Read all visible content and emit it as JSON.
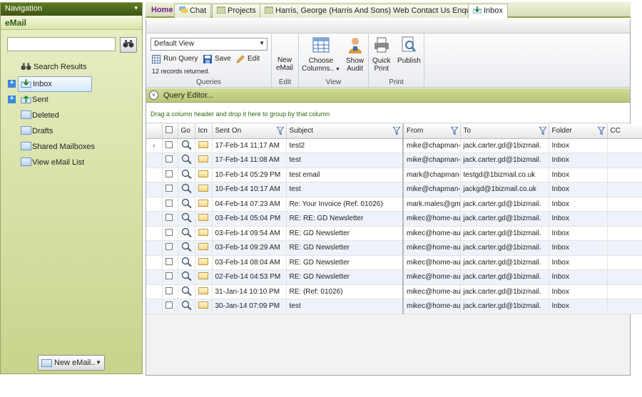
{
  "nav": {
    "header": "Navigation",
    "section_title": "eMail",
    "search_placeholder": "",
    "items": [
      {
        "label": "Search Results",
        "icon": "binoculars-icon"
      },
      {
        "label": "Inbox",
        "icon": "inbox-icon"
      },
      {
        "label": "Sent",
        "icon": "sent-icon"
      },
      {
        "label": "Deleted",
        "icon": "envelope-icon"
      },
      {
        "label": "Drafts",
        "icon": "envelope-icon"
      },
      {
        "label": "Shared Mailboxes",
        "icon": "envelope-icon"
      },
      {
        "label": "View eMail List",
        "icon": "envelope-icon"
      }
    ],
    "new_email": "New eMail.."
  },
  "tabs": [
    {
      "label": "Home"
    },
    {
      "label": "Chat"
    },
    {
      "label": "Projects"
    },
    {
      "label": "Harris, George (Harris And Sons) Web Contact Us Enquiry"
    },
    {
      "label": "Inbox"
    }
  ],
  "ribbon": {
    "view_select": "Default View",
    "run_query": "Run Query",
    "save": "Save",
    "edit": "Edit",
    "records_returned": "12 records returned.",
    "queries_label": "Queries",
    "new_email_line1": "New",
    "new_email_line2": "eMail",
    "edit_group_label": "Edit",
    "choose_columns_line1": "Choose",
    "choose_columns_line2": "Columns..",
    "show_audit_line1": "Show",
    "show_audit_line2": "Audit",
    "view_group_label": "View",
    "quick_print_line1": "Quick",
    "quick_print_line2": "Print",
    "publish": "Publish",
    "print_group_label": "Print"
  },
  "query_editor": "Query Editor...",
  "group_hint": "Drag a column header and drop it here to group by that column",
  "grid": {
    "columns": {
      "go": "Go",
      "icn": "Icn",
      "sent_on": "Sent On",
      "subject": "Subject",
      "from": "From",
      "to": "To",
      "folder": "Folder",
      "cc": "CC"
    },
    "rows": [
      {
        "sent": "17-Feb-14 11:17 AM",
        "subject": "test2",
        "from": "mike@chapman-",
        "to": "jack.carter.gd@1bizmail.",
        "folder": "Inbox"
      },
      {
        "sent": "17-Feb-14 11:08 AM",
        "subject": "test",
        "from": "mike@chapman-",
        "to": "jack.carter.gd@1bizmail.",
        "folder": "Inbox"
      },
      {
        "sent": "10-Feb-14 05:29 PM",
        "subject": "test email",
        "from": "mark@chapman-",
        "to": "testgd@1bizmail.co.uk",
        "folder": "Inbox"
      },
      {
        "sent": "10-Feb-14 10:17 AM",
        "subject": "test",
        "from": "mike@chapman-",
        "to": "jackgd@1bizmail.co.uk",
        "folder": "Inbox"
      },
      {
        "sent": "04-Feb-14 07:23 AM",
        "subject": "Re: Your Invoice (Ref: 01026)",
        "from": "mark.males@gm",
        "to": "jack.carter.gd@1bizmail.",
        "folder": "Inbox"
      },
      {
        "sent": "03-Feb-14 05:04 PM",
        "subject": "RE: RE: GD Newsletter",
        "from": "mikec@home-au",
        "to": "jack.carter.gd@1bizmail.",
        "folder": "Inbox"
      },
      {
        "sent": "03-Feb-14 09:54 AM",
        "subject": "RE: GD Newsletter",
        "from": "mikec@home-au",
        "to": "jack.carter.gd@1bizmail.",
        "folder": "Inbox"
      },
      {
        "sent": "03-Feb-14 09:29 AM",
        "subject": "RE: GD Newsletter",
        "from": "mikec@home-au",
        "to": "jack.carter.gd@1bizmail.",
        "folder": "Inbox"
      },
      {
        "sent": "03-Feb-14 08:04 AM",
        "subject": "RE: GD Newsletter",
        "from": "mikec@home-au",
        "to": "jack.carter.gd@1bizmail.",
        "folder": "Inbox"
      },
      {
        "sent": "02-Feb-14 04:53 PM",
        "subject": "RE: GD Newsletter",
        "from": "mikec@home-au",
        "to": "jack.carter.gd@1bizmail.",
        "folder": "Inbox"
      },
      {
        "sent": "31-Jan-14 10:10 PM",
        "subject": "RE: (Ref: 01026)",
        "from": "mikec@home-au",
        "to": "jack.carter.gd@1bizmail.",
        "folder": "Inbox"
      },
      {
        "sent": "30-Jan-14 07:09 PM",
        "subject": "test",
        "from": "mikec@home-au",
        "to": "jack.carter.gd@1bizmail.",
        "folder": "Inbox"
      }
    ]
  },
  "colors": {
    "nav_header": "#4d6a1a",
    "accent_green": "#b8c77a",
    "row_alt": "#eef3fa",
    "home_tab": "#7a1b8f"
  }
}
